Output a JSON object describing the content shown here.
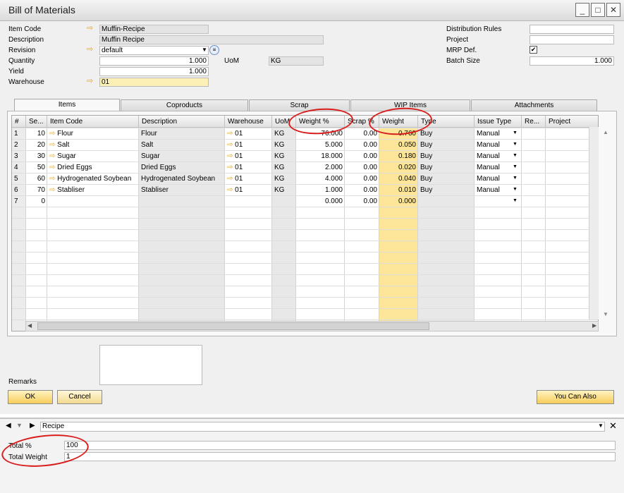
{
  "window": {
    "title": "Bill of Materials",
    "minimize": "_",
    "maximize": "□",
    "close": "✕"
  },
  "header": {
    "item_code_label": "Item Code",
    "item_code_value": "Muffin-Recipe",
    "description_label": "Description",
    "description_value": "Muffin Recipe",
    "revision_label": "Revision",
    "revision_value": "default",
    "quantity_label": "Quantity",
    "quantity_value": "1.000",
    "uom_label": "UoM",
    "uom_value": "KG",
    "yield_label": "Yield",
    "yield_value": "1.000",
    "warehouse_label": "Warehouse",
    "warehouse_value": "01",
    "distribution_rules_label": "Distribution Rules",
    "distribution_rules_value": "",
    "project_label": "Project",
    "project_value": "",
    "mrp_def_label": "MRP Def.",
    "mrp_def_checked": true,
    "batch_size_label": "Batch Size",
    "batch_size_value": "1.000"
  },
  "tabs": [
    "Items",
    "Coproducts",
    "Scrap",
    "WIP Items",
    "Attachments"
  ],
  "columns": [
    "#",
    "Se...",
    "Item Code",
    "Description",
    "Warehouse",
    "UoM",
    "Weight %",
    "Scrap %",
    "Weight",
    "Type",
    "Issue Type",
    "Re...",
    "Project"
  ],
  "rows": [
    {
      "num": "1",
      "seq": "10",
      "item": "Flour",
      "desc": "Flour",
      "wh": "01",
      "uom": "KG",
      "wpct": "76.000",
      "scrap": "0.00",
      "weight": "0.760",
      "type": "Buy",
      "issue": "Manual"
    },
    {
      "num": "2",
      "seq": "20",
      "item": "Salt",
      "desc": "Salt",
      "wh": "01",
      "uom": "KG",
      "wpct": "5.000",
      "scrap": "0.00",
      "weight": "0.050",
      "type": "Buy",
      "issue": "Manual"
    },
    {
      "num": "3",
      "seq": "30",
      "item": "Sugar",
      "desc": "Sugar",
      "wh": "01",
      "uom": "KG",
      "wpct": "18.000",
      "scrap": "0.00",
      "weight": "0.180",
      "type": "Buy",
      "issue": "Manual"
    },
    {
      "num": "4",
      "seq": "50",
      "item": "Dried Eggs",
      "desc": "Dried Eggs",
      "wh": "01",
      "uom": "KG",
      "wpct": "2.000",
      "scrap": "0.00",
      "weight": "0.020",
      "type": "Buy",
      "issue": "Manual"
    },
    {
      "num": "5",
      "seq": "60",
      "item": "Hydrogenated Soybean",
      "desc": "Hydrogenated Soybean",
      "wh": "01",
      "uom": "KG",
      "wpct": "4.000",
      "scrap": "0.00",
      "weight": "0.040",
      "type": "Buy",
      "issue": "Manual"
    },
    {
      "num": "6",
      "seq": "70",
      "item": "Stabliser",
      "desc": "Stabliser",
      "wh": "01",
      "uom": "KG",
      "wpct": "1.000",
      "scrap": "0.00",
      "weight": "0.010",
      "type": "Buy",
      "issue": "Manual"
    },
    {
      "num": "7",
      "seq": "0",
      "item": "",
      "desc": "",
      "wh": "",
      "uom": "",
      "wpct": "0.000",
      "scrap": "0.00",
      "weight": "0.000",
      "type": "",
      "issue": ""
    }
  ],
  "remarks_label": "Remarks",
  "buttons": {
    "ok": "OK",
    "cancel": "Cancel",
    "you_can_also": "You Can Also"
  },
  "bottom": {
    "selector_value": "Recipe",
    "total_pct_label": "Total %",
    "total_pct_value": "100",
    "total_weight_label": "Total Weight",
    "total_weight_value": "1"
  },
  "colors": {
    "highlight_yellow": "#fde69a",
    "annotation_red": "#d91e1e",
    "arrow_orange": "#e8a317"
  }
}
